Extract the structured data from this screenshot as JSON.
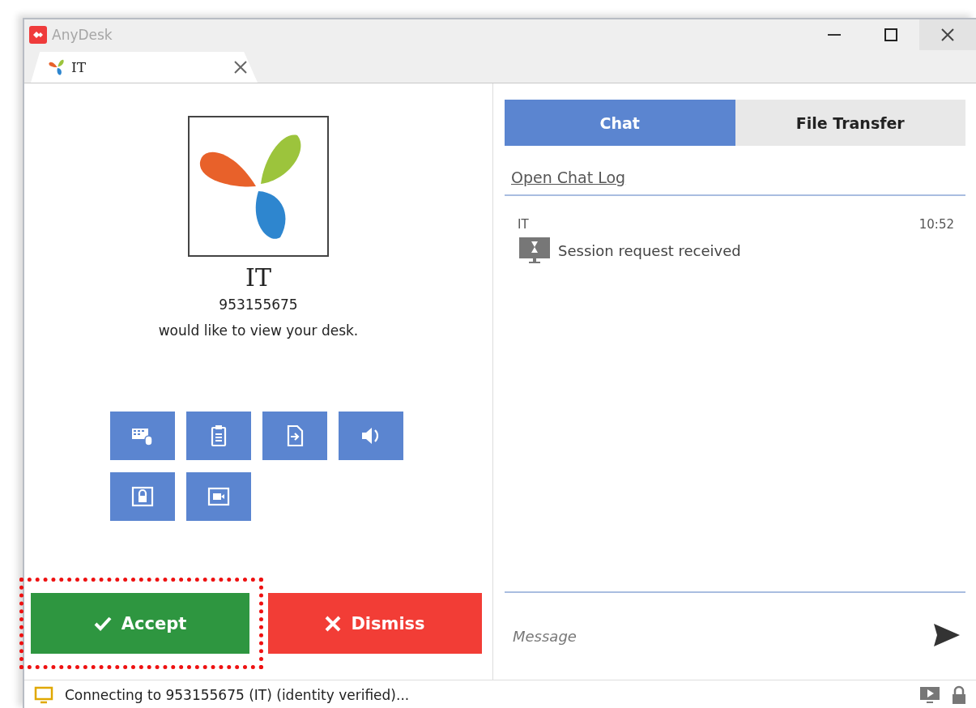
{
  "window": {
    "title": "AnyDesk"
  },
  "tabs": [
    {
      "label": "IT",
      "selected": true
    }
  ],
  "request": {
    "name": "IT",
    "id": "953155675",
    "message": "would like to view your desk."
  },
  "permissions": [
    {
      "kind": "keyboard"
    },
    {
      "kind": "clipboard"
    },
    {
      "kind": "file"
    },
    {
      "kind": "sound"
    },
    {
      "kind": "lock"
    },
    {
      "kind": "video"
    }
  ],
  "actions": [
    {
      "kind": "accept",
      "label": "Accept",
      "highlighted": true
    },
    {
      "kind": "dismiss",
      "label": "Dismiss",
      "highlighted": false
    }
  ],
  "chat_tabs": [
    {
      "label": "Chat",
      "selected": true
    },
    {
      "label": "File Transfer",
      "selected": false
    }
  ],
  "chat_log_link": "Open Chat Log",
  "messages": [
    {
      "sender": "IT",
      "time": "10:52",
      "text": "Session request received"
    }
  ],
  "message_field": {
    "placeholder": "Message"
  },
  "status_bar": {
    "text": "Connecting to 953155675 (IT) (identity verified)..."
  }
}
